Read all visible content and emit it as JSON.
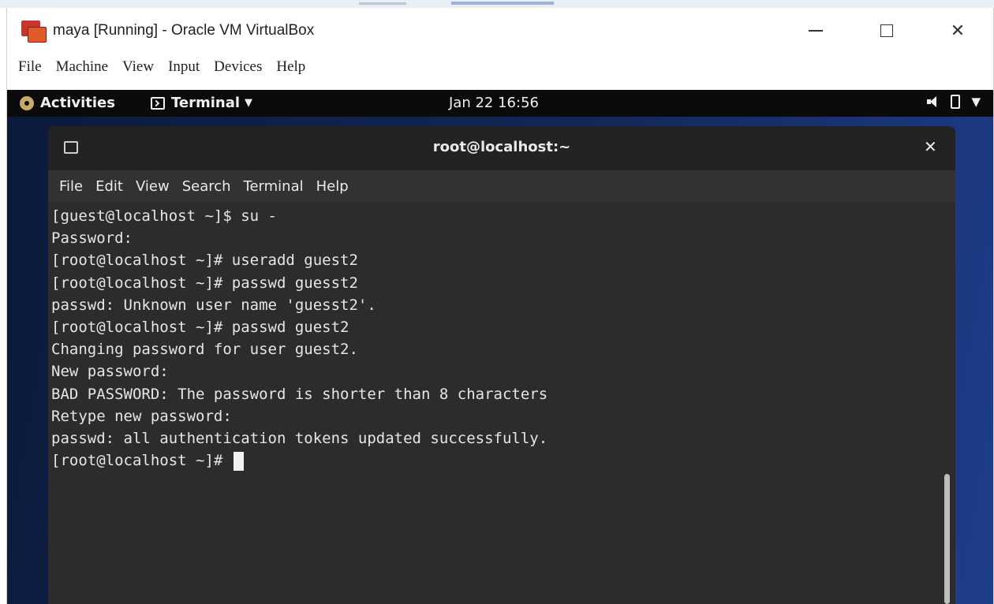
{
  "vbox": {
    "title": "maya [Running] - Oracle VM VirtualBox",
    "menu": [
      "File",
      "Machine",
      "View",
      "Input",
      "Devices",
      "Help"
    ]
  },
  "gnome": {
    "activities": "Activities",
    "app_menu": "Terminal",
    "clock": "Jan 22 16:56"
  },
  "terminal": {
    "title": "root@localhost:~",
    "menu": [
      "File",
      "Edit",
      "View",
      "Search",
      "Terminal",
      "Help"
    ],
    "lines": [
      "[guest@localhost ~]$ su -",
      "Password:",
      "[root@localhost ~]# useradd guest2",
      "[root@localhost ~]# passwd guesst2",
      "passwd: Unknown user name 'guesst2'.",
      "[root@localhost ~]# passwd guest2",
      "Changing password for user guest2.",
      "New password:",
      "BAD PASSWORD: The password is shorter than 8 characters",
      "Retype new password:",
      "passwd: all authentication tokens updated successfully.",
      "[root@localhost ~]# "
    ]
  },
  "icons": {
    "app_logo": "virtualbox-icon",
    "gnome_activities": "gnome-activities-icon",
    "terminal": "terminal-icon",
    "volume": "volume-icon",
    "battery": "battery-icon",
    "dropdown": "chevron-down-icon"
  }
}
